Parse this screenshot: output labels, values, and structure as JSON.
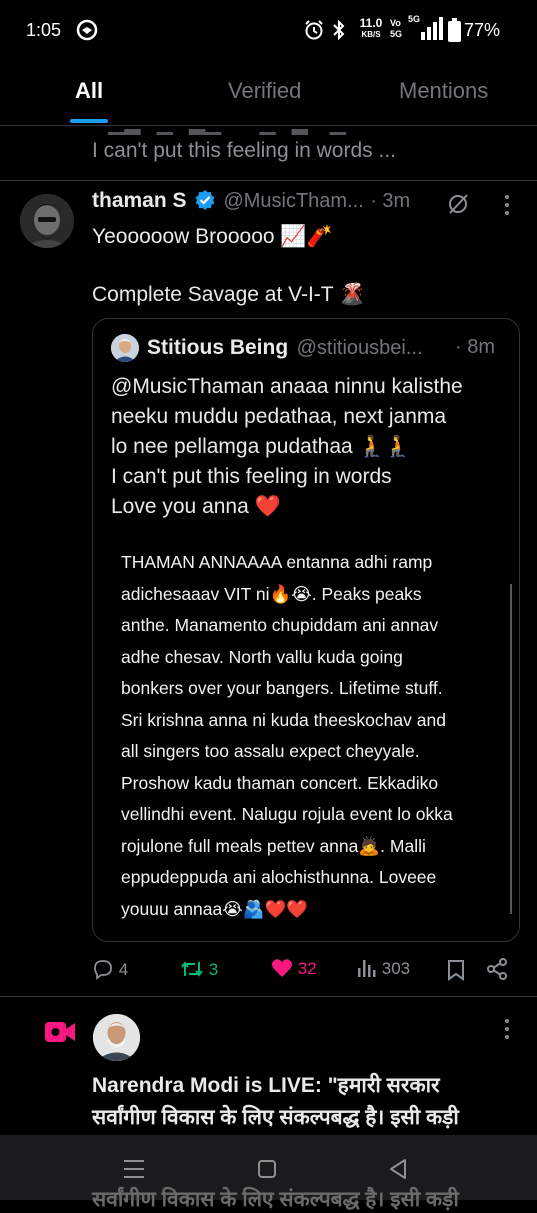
{
  "status_bar": {
    "time": "1:05",
    "net_speed_top": "11.0",
    "net_speed_unit": "KB/S",
    "volte_top": "Vo",
    "volte_bottom": "5G",
    "signal_label": "5G",
    "battery": "77%"
  },
  "tabs": [
    {
      "label": "All",
      "active": true
    },
    {
      "label": "Verified",
      "active": false
    },
    {
      "label": "Mentions",
      "active": false
    }
  ],
  "prev_tweet": {
    "partial_line": "I can't put this feeling in words ..."
  },
  "tweet": {
    "author": "thaman S",
    "handle": "@MusicTham...",
    "time": "· 3m",
    "line1": "Yeooooow Brooooo 📈🧨",
    "line2": "Complete Savage at V-I-T 🌋",
    "quote": {
      "author": "Stitious Being",
      "handle": "@stitiousbei...",
      "time": "· 8m",
      "lines": [
        "@MusicThaman anaaa ninnu kalisthe",
        "neeku muddu pedathaa, next janma",
        "lo nee pellamga pudathaa 🧎🧎",
        "I can't put this feeling in words",
        "Love you anna ❤️"
      ],
      "body_lines": [
        "THAMAN ANNAAAA entanna adhi ramp",
        "adichesaaav VIT ni🔥😭. Peaks peaks",
        "anthe. Manamento chupiddam ani annav",
        "adhe chesav. North vallu kuda going",
        "bonkers over your bangers. Lifetime stuff.",
        "Sri krishna anna ni kuda theeskochav and",
        "all  singers too assalu expect cheyyale.",
        "Proshow kadu thaman concert. Ekkadiko",
        "vellindhi event. Nalugu rojula event lo okka",
        "rojulone full meals pettev anna🙇. Malli",
        "eppudeppuda ani alochisthunna. Loveee",
        "youuu annaa😭🫂❤️❤️"
      ]
    },
    "actions": {
      "replies": "4",
      "retweets": "3",
      "likes": "32",
      "views": "303"
    }
  },
  "live_notification": {
    "author": "Narendra Modi",
    "suffix": " is LIVE: \"हमारी सरकार",
    "line2": "सर्वांगीण विकास के लिए संकल्पबद्ध है। इसी कड़ी",
    "line3_partial": "सर्वांगीण विकास के लिए संकल्पबद्ध है। इसी कड़ी"
  },
  "colors": {
    "accent_blue": "#1d9bf0",
    "retweet_green": "#00ba7c",
    "like_pink": "#f91880",
    "live_pink": "#f91880",
    "text_gray": "#71767b"
  }
}
